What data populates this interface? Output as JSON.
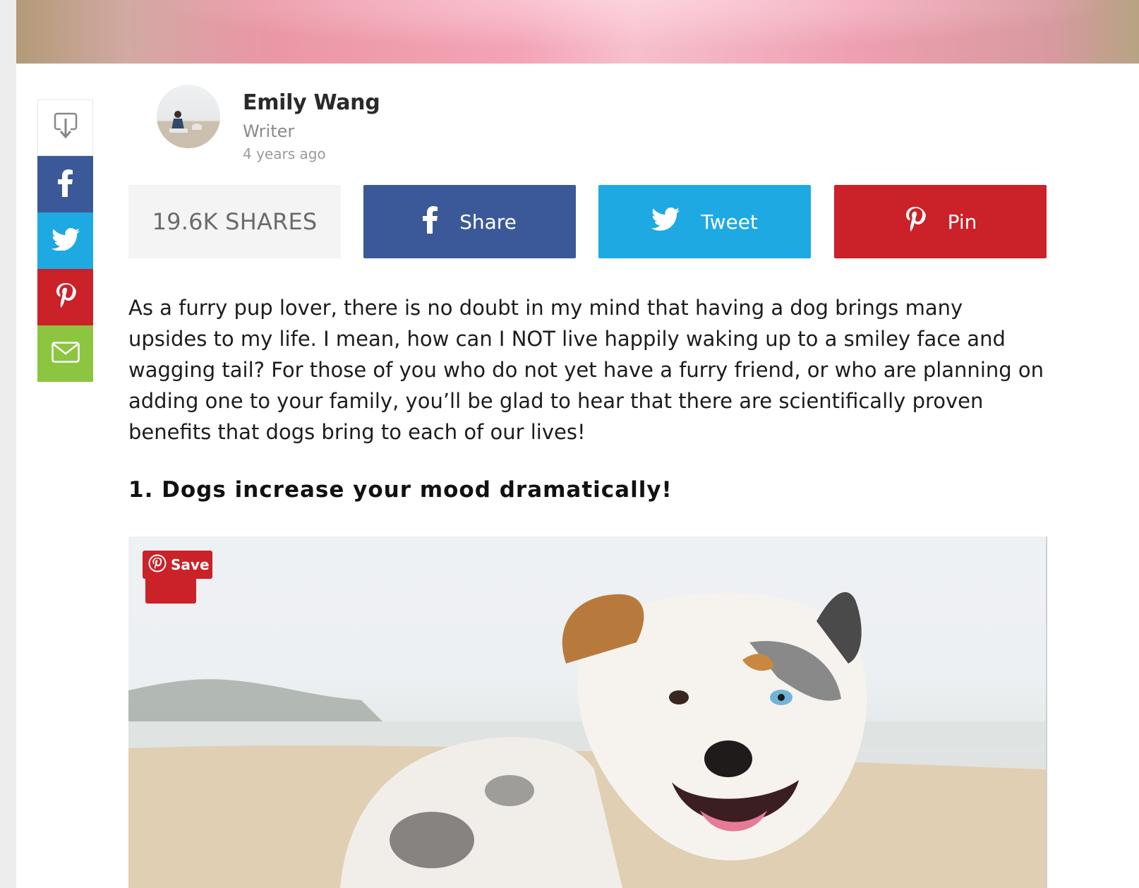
{
  "author": {
    "name": "Emily Wang",
    "role": "Writer",
    "time": "4 years ago"
  },
  "share_bar": {
    "count_label": "19.6K SHARES",
    "facebook_label": "Share",
    "twitter_label": "Tweet",
    "pinterest_label": "Pin"
  },
  "sidebar": {
    "items": [
      "download-icon",
      "facebook-icon",
      "twitter-icon",
      "pinterest-icon",
      "mail-icon"
    ]
  },
  "article": {
    "intro": "As a furry pup lover, there is no doubt in my mind that having a dog brings many upsides to my life. I mean, how can I NOT live happily waking up to a smiley face and wagging tail? For those of you who do not yet have a furry friend, or who are planning on adding one to your family, you’ll be glad to hear that there are scientifically proven benefits that dogs bring to each of our lives!",
    "heading_1": "1. Dogs increase your mood dramatically!"
  },
  "image_overlay": {
    "save_label": "Save"
  },
  "colors": {
    "facebook": "#3b5998",
    "twitter": "#1ea9e2",
    "pinterest": "#cb2128",
    "mail": "#8cc540"
  }
}
